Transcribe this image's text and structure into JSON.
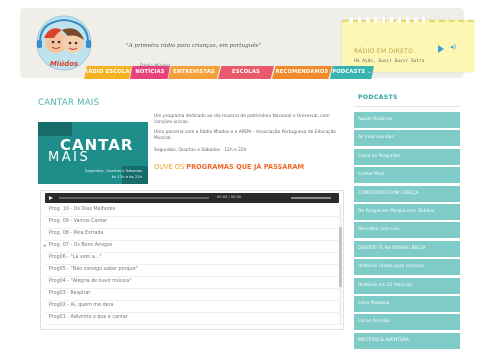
{
  "header": {
    "tagline": "\"A primeira rádio para crianças, em português\"",
    "slogan_small": "Rádio Miúdos"
  },
  "player": {
    "title": "RÁDIO EM DIRETO",
    "subtitle": "Há Ação, Ouvir  Ouvir Outra"
  },
  "nav": {
    "items": [
      {
        "label": "RÁDIO ESCOLAS",
        "color": "#f4b323"
      },
      {
        "label": "NOTÍCIAS",
        "color": "#e9437e"
      },
      {
        "label": "ENTREVISTAS",
        "color": "#f4a13a"
      },
      {
        "label": "ESCOLAS",
        "color": "#e95a6c"
      },
      {
        "label": "RECOMENDAMOS",
        "color": "#f08a2a"
      },
      {
        "label": "PODCASTS ⌄",
        "color": "#39b4b0"
      }
    ]
  },
  "main": {
    "title": "CANTAR MAIS",
    "banner": {
      "cantar": "CANTAR",
      "mais": "MAIS",
      "days": "Segundas, Quartas e Sábados",
      "hours": "às 12h e às 22h"
    },
    "desc_1": "Um programa dedicado ao dia musical do património Nacional e Universal, com canções únicas.",
    "desc_2": "Uma parceria com a Rádio Miúdos e a APEM – Associação Portuguesa de Educação Musical.",
    "desc_3": "Segundas, Quartas e Sábados · 12h e 22h",
    "heard_heading_pre": "OUVE OS ",
    "heard_heading_bold": "PROGRAMAS QUE JÁ PASSARAM",
    "audio_time": "00:00 / 00:00"
  },
  "tracks": [
    "Prog. 10 - Os Dias Melhores",
    "Prog. 09 - Vamos Cantar",
    "Prog. 08 - Pela Estrada",
    "Prog. 07 - Os Bons Amigos",
    "Prog06 - \"Lá vem a...\"",
    "Prog05 - \"Não consigo saber porque\"",
    "Prog04 - \"Alegria de ouvir música\"",
    "Prog03 - Respirar",
    "Prog02 - Ai, quem me dera",
    "Prog01 - Adivinha o que é cantar"
  ],
  "playing_index": 3,
  "audio_progress_fraction": 0.0,
  "sidebar": {
    "title": "PODCASTS",
    "items": [
      "Aquilo Histórias",
      "As mais ouvidas",
      "Caixa de Perguntas",
      "Contar Mais",
      "COMEDOURO COM CABEÇA",
      "De Parque em Parque com Teddies",
      "Descobrir com Leo",
      "DIVERTE-TE NA NOSSA LÍNGUA",
      "Histórias Lindas para crianças",
      "Histórias em 22 Palavras",
      "Letra Pequena",
      "Livros Animais",
      "MISTÉRIO & AVENTURA"
    ]
  }
}
